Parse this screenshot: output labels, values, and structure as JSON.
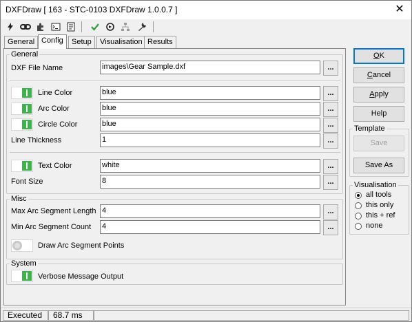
{
  "window": {
    "title": "DXFDraw [ 163 - STC-0103 DXFDraw 1.0.0.7 ]",
    "close_glyph": "✕"
  },
  "tabs": [
    {
      "label": "General"
    },
    {
      "label": "Config"
    },
    {
      "label": "Setup"
    },
    {
      "label": "Visualisation"
    },
    {
      "label": "Results"
    }
  ],
  "groups": {
    "general": "General",
    "misc": "Misc",
    "system": "System"
  },
  "fields": {
    "dxf_file_name": {
      "label": "DXF File Name",
      "value": "images\\Gear Sample.dxf"
    },
    "line_color": {
      "label": "Line Color",
      "value": "blue"
    },
    "arc_color": {
      "label": "Arc Color",
      "value": "blue"
    },
    "circle_color": {
      "label": "Circle Color",
      "value": "blue"
    },
    "line_thickness": {
      "label": "Line Thickness",
      "value": "1"
    },
    "text_color": {
      "label": "Text Color",
      "value": "white"
    },
    "font_size": {
      "label": "Font Size",
      "value": "8"
    },
    "max_arc_segment_length": {
      "label": "Max Arc Segment Length",
      "value": "4"
    },
    "min_arc_segment_count": {
      "label": "Min Arc Segment Count",
      "value": "4"
    },
    "draw_arc_segment_points": {
      "label": "Draw Arc Segment Points"
    },
    "verbose_message_output": {
      "label": "Verbose Message Output"
    }
  },
  "browse_label": "...",
  "buttons": {
    "ok_underline": "O",
    "ok_rest": "K",
    "cancel_underline": "C",
    "cancel_rest": "ancel",
    "apply_underline": "A",
    "apply_rest": "pply",
    "help": "Help",
    "save": "Save",
    "save_as": "Save As"
  },
  "template": {
    "label": "Template"
  },
  "visualisation": {
    "label": "Visualisation",
    "options": [
      "all tools",
      "this only",
      "this + ref",
      "none"
    ],
    "selected": "all tools"
  },
  "status": {
    "state": "Executed",
    "time": "68.7 ms"
  },
  "colors": {
    "toggle_on": "#3cb44b",
    "default_border": "#0078d7",
    "check": "#2e9e3e"
  },
  "toolbar_icons": [
    "lightning-icon",
    "link-icon",
    "puzzle-icon",
    "terminal-icon",
    "document-list-icon",
    "checkmark-icon",
    "run-step-icon",
    "network-icon",
    "wrench-icon"
  ]
}
